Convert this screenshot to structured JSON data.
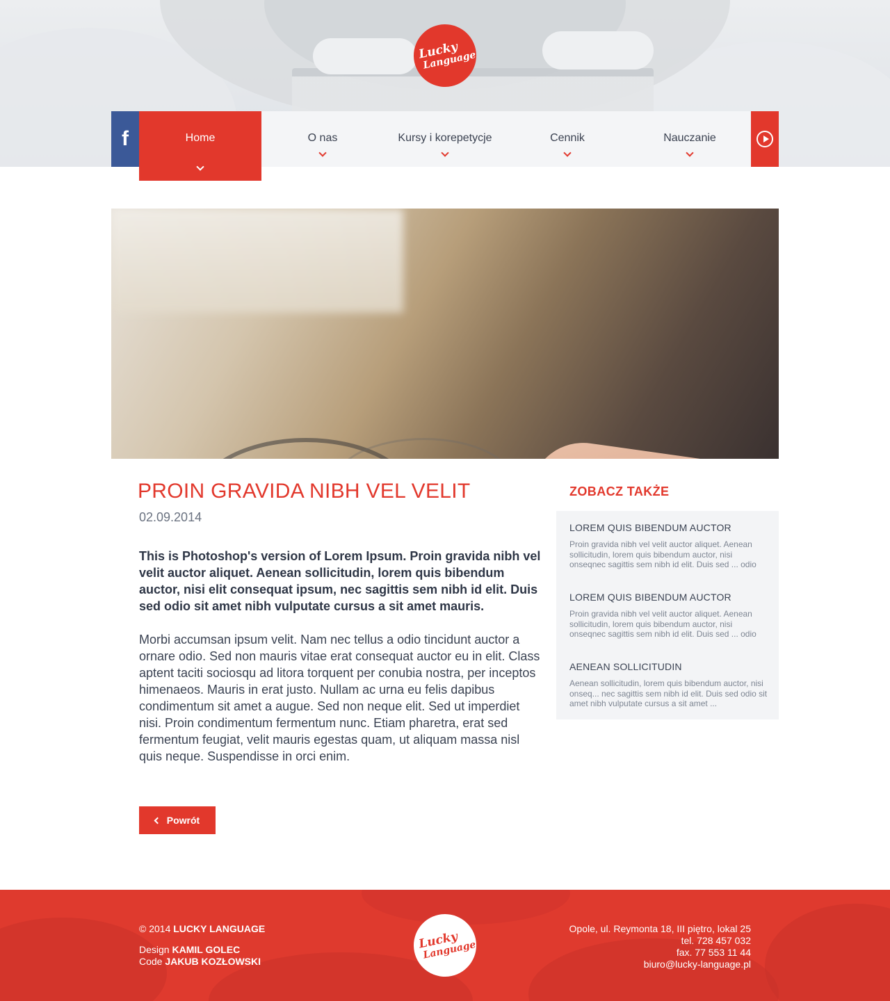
{
  "brand": {
    "logo_line1": "Lucky",
    "logo_line2": "Language"
  },
  "nav": {
    "items": [
      {
        "label": "Home",
        "active": true
      },
      {
        "label": "O nas"
      },
      {
        "label": "Kursy i korepetycje"
      },
      {
        "label": "Cennik"
      },
      {
        "label": "Nauczanie"
      }
    ]
  },
  "article": {
    "title": "PROIN GRAVIDA NIBH VEL VELIT",
    "date": "02.09.2014",
    "lead": "This is Photoshop's version  of Lorem Ipsum. Proin gravida nibh vel velit auctor aliquet. Aenean sollicitudin, lorem quis bibendum auctor, nisi elit consequat ipsum, nec sagittis sem nibh id elit. Duis sed odio sit amet nibh vulputate cursus a sit amet mauris.",
    "body": "Morbi accumsan ipsum velit. Nam nec tellus a odio tincidunt auctor a ornare odio. Sed non  mauris vitae erat consequat auctor eu in elit. Class aptent taciti sociosqu ad litora torquent per conubia nostra, per inceptos himenaeos. Mauris in erat justo. Nullam ac urna eu felis dapibus condimentum sit amet a augue. Sed non neque elit. Sed ut imperdiet nisi. Proin condimentum fermentum nunc. Etiam pharetra, erat sed fermentum feugiat, velit mauris egestas quam, ut aliquam massa nisl quis neque. Suspendisse in orci enim.",
    "back_label": "Powrót"
  },
  "sidebar": {
    "title": "ZOBACZ TAKŻE",
    "items": [
      {
        "title": "LOREM QUIS BIBENDUM AUCTOR",
        "text": "Proin gravida nibh vel velit auctor aliquet. Aenean sollicitudin, lorem quis bibendum auctor, nisi onseqnec sagittis sem nibh id elit. Duis sed ... odio"
      },
      {
        "title": "LOREM QUIS BIBENDUM AUCTOR",
        "text": "Proin gravida nibh vel velit auctor aliquet. Aenean sollicitudin, lorem quis bibendum auctor, nisi onseqnec sagittis sem nibh id elit. Duis sed ... odio"
      },
      {
        "title": "AENEAN SOLLICITUDIN",
        "text": "Aenean sollicitudin, lorem quis bibendum auctor, nisi onseq... nec sagittis sem nibh id elit. Duis sed odio sit amet nibh vulputate cursus a sit amet ..."
      }
    ]
  },
  "footer": {
    "copyright_prefix": "© 2014",
    "company": "LUCKY LANGUAGE",
    "design_label": "Design",
    "designer": "KAMIL GOLEC",
    "code_label": "Code",
    "coder": "JAKUB KOZŁOWSKI",
    "address": "Opole, ul. Reymonta 18, III piętro, lokal 25",
    "phone": "tel. 728 457 032",
    "fax": "fax. 77 553 11 44",
    "email": "biuro@lucky-language.pl"
  },
  "colors": {
    "accent": "#e2382c",
    "facebook": "#3b5998",
    "text": "#333d4d"
  },
  "icons": {
    "facebook": "facebook-icon",
    "play": "play-circle-icon",
    "back": "chevron-left-icon",
    "nav_chevron": "chevron-down-icon"
  }
}
